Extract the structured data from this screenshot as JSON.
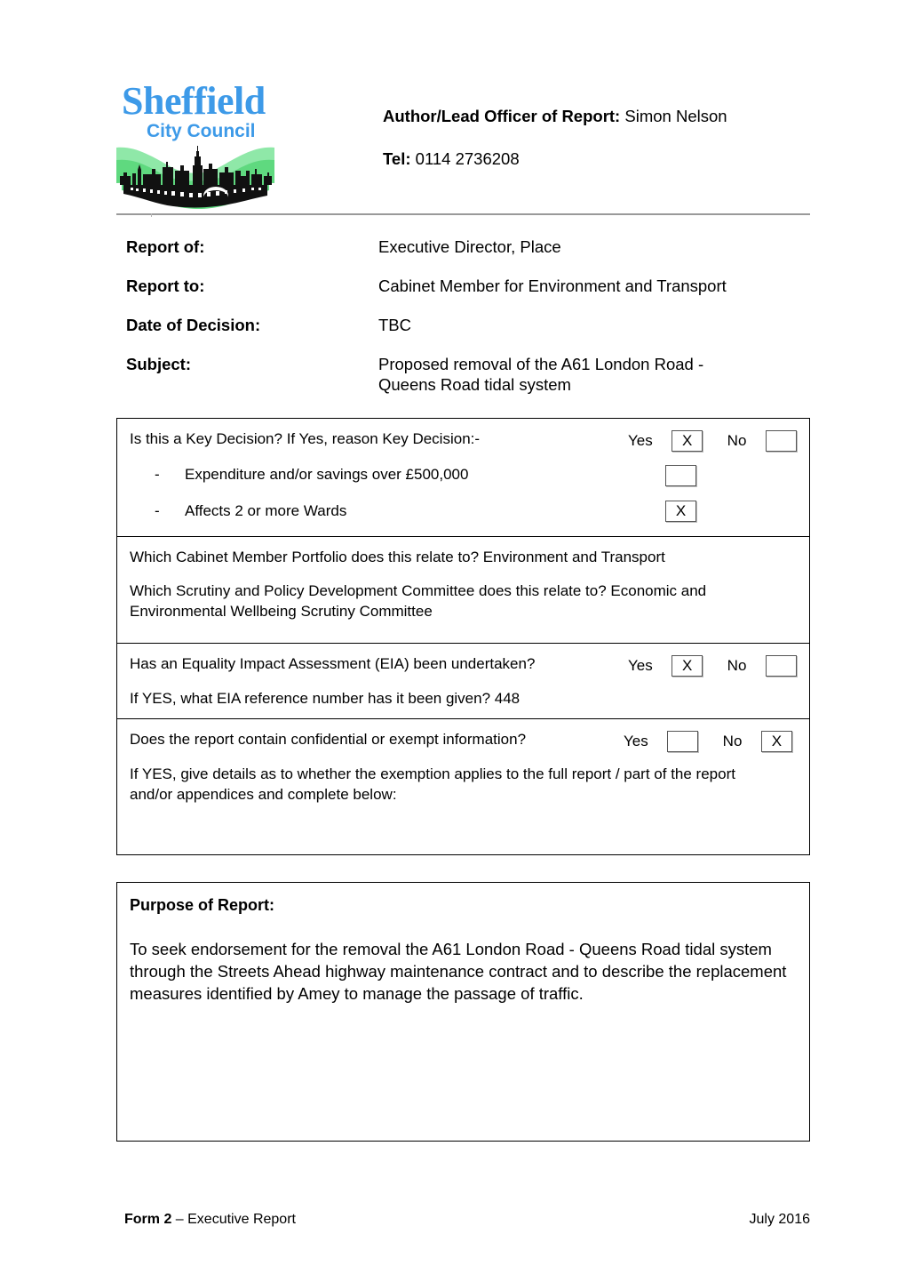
{
  "document": {
    "logo": {
      "word_mark": "Sheffield",
      "sub_mark": "City Council",
      "brand_blue": "#3d9ae8",
      "brand_green_light": "#8fe8a8",
      "brand_green": "#5fd97f",
      "art_alt": "sheffield-skyline-hills"
    },
    "header": {
      "author_label": "Author/Lead Officer of Report:",
      "author_value": "Simon Nelson",
      "tel_label": "Tel:",
      "tel_value": "0114 2736208"
    },
    "meta": [
      {
        "label": "Report of:",
        "value": "Executive Director, Place"
      },
      {
        "label": "Report to:",
        "value": "Cabinet Member for Environment and Transport"
      },
      {
        "label": "Date of Decision:",
        "value": "TBC"
      },
      {
        "label": "Subject:",
        "value": "Proposed removal of the A61 London Road - Queens Road tidal system"
      }
    ],
    "form": {
      "key_decision": {
        "question": "Is this a Key Decision? If Yes, reason Key Decision:-",
        "yes_label": "Yes",
        "yes_mark": "X",
        "no_label": "No",
        "no_mark": "",
        "reasons": [
          {
            "dash": "-",
            "text": "Expenditure and/or savings over £500,000",
            "mark": ""
          },
          {
            "dash": "-",
            "text": "Affects 2 or more Wards",
            "mark": "X"
          }
        ]
      },
      "portfolio": {
        "line1": "Which Cabinet Member Portfolio does this relate to?   Environment and Transport",
        "line2": "Which Scrutiny and Policy Development Committee does this relate to?  Economic and Environmental Wellbeing Scrutiny Committee"
      },
      "eia": {
        "question": "Has an Equality Impact Assessment (EIA) been undertaken?",
        "yes_label": "Yes",
        "yes_mark": "X",
        "no_label": "No",
        "no_mark": "",
        "reference_line": "If YES, what EIA reference number has it been given?   448"
      },
      "confidential": {
        "question": "Does the report contain confidential or exempt information?",
        "yes_label": "Yes",
        "yes_mark": "",
        "no_label": "No",
        "no_mark": "X",
        "detail_line": "If YES, give details as to whether the exemption applies to the full report / part of the report and/or appendices and complete below:"
      }
    },
    "purpose": {
      "title": "Purpose of Report:",
      "body": "To seek endorsement for the removal the A61 London Road - Queens Road tidal system through the Streets Ahead highway maintenance contract and to describe the replacement measures identified by Amey to manage the passage of traffic."
    },
    "footer": {
      "form_name": "Form 2",
      "form_rest": " – Executive Report",
      "date": "July 2016"
    }
  }
}
